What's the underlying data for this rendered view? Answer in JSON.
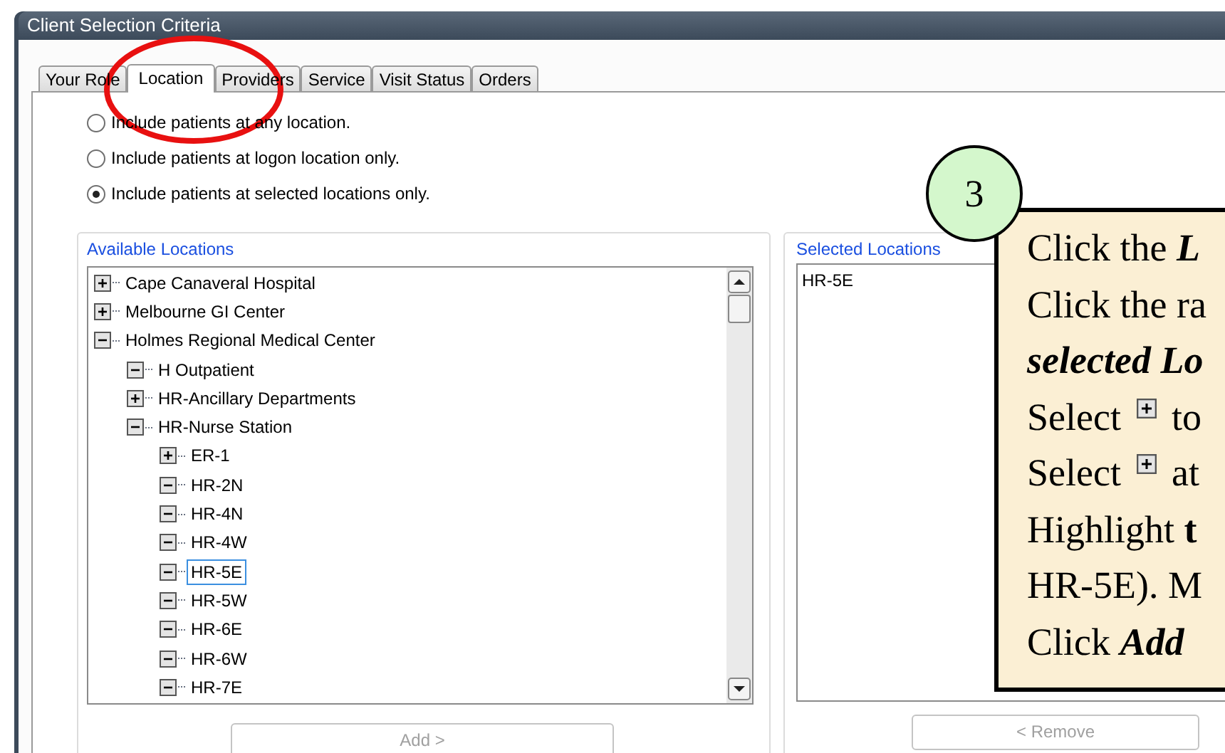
{
  "window": {
    "title": "Client Selection Criteria"
  },
  "tabs": [
    {
      "label": "Your Role",
      "selected": false
    },
    {
      "label": "Location",
      "selected": true
    },
    {
      "label": "Providers",
      "selected": false
    },
    {
      "label": "Service",
      "selected": false
    },
    {
      "label": "Visit Status",
      "selected": false
    },
    {
      "label": "Orders",
      "selected": false
    }
  ],
  "radio_options": [
    {
      "label": "Include patients at any location.",
      "selected": false
    },
    {
      "label": "Include patients at logon location only.",
      "selected": false
    },
    {
      "label": "Include patients at selected locations only.",
      "selected": true
    }
  ],
  "available_locations": {
    "label": "Available Locations",
    "tree": [
      {
        "label": "Cape Canaveral Hospital",
        "expanded": false,
        "selected": false
      },
      {
        "label": "Melbourne GI Center",
        "expanded": false,
        "selected": false
      },
      {
        "label": "Holmes Regional Medical Center",
        "expanded": true,
        "selected": false,
        "children": [
          {
            "label": "H Outpatient",
            "expanded": true,
            "selected": false
          },
          {
            "label": "HR-Ancillary Departments",
            "expanded": false,
            "selected": false
          },
          {
            "label": "HR-Nurse Station",
            "expanded": true,
            "selected": false,
            "children": [
              {
                "label": "ER-1",
                "expanded": false,
                "selected": false
              },
              {
                "label": "HR-2N",
                "expanded": true,
                "selected": false
              },
              {
                "label": "HR-4N",
                "expanded": true,
                "selected": false
              },
              {
                "label": "HR-4W",
                "expanded": true,
                "selected": false
              },
              {
                "label": "HR-5E",
                "expanded": true,
                "selected": true
              },
              {
                "label": "HR-5W",
                "expanded": true,
                "selected": false
              },
              {
                "label": "HR-6E",
                "expanded": true,
                "selected": false
              },
              {
                "label": "HR-6W",
                "expanded": true,
                "selected": false
              },
              {
                "label": "HR-7E",
                "expanded": true,
                "selected": false
              }
            ]
          }
        ]
      }
    ]
  },
  "add_button": {
    "label": "Add >",
    "disabled": true
  },
  "selected_locations": {
    "label": "Selected Locations",
    "items": [
      "HR-5E"
    ]
  },
  "remove_button": {
    "label": "< Remove",
    "disabled": true
  },
  "callout": {
    "step": "3",
    "lines": [
      [
        {
          "kind": "text",
          "text": "Click the ",
          "bold": false,
          "italic": false
        },
        {
          "kind": "text",
          "text": "L",
          "bold": true,
          "italic": true
        }
      ],
      [
        {
          "kind": "text",
          "text": "Click the ra",
          "bold": false,
          "italic": false
        }
      ],
      [
        {
          "kind": "text",
          "text": "selected Lo",
          "bold": true,
          "italic": true
        }
      ],
      [
        {
          "kind": "text",
          "text": "Select ",
          "bold": false,
          "italic": false
        },
        {
          "kind": "plus_icon"
        },
        {
          "kind": "text",
          "text": " to",
          "bold": false,
          "italic": false
        }
      ],
      [
        {
          "kind": "text",
          "text": "Select ",
          "bold": false,
          "italic": false
        },
        {
          "kind": "plus_icon"
        },
        {
          "kind": "text",
          "text": " at",
          "bold": false,
          "italic": false
        }
      ],
      [
        {
          "kind": "text",
          "text": "Highlight ",
          "bold": false,
          "italic": false
        },
        {
          "kind": "text",
          "text": "t",
          "bold": true,
          "italic": false
        }
      ],
      [
        {
          "kind": "text",
          "text": "HR-5E). M",
          "bold": false,
          "italic": false
        }
      ],
      [
        {
          "kind": "text",
          "text": "Click ",
          "bold": false,
          "italic": false
        },
        {
          "kind": "text",
          "text": "Add",
          "bold": true,
          "italic": true
        }
      ]
    ]
  }
}
